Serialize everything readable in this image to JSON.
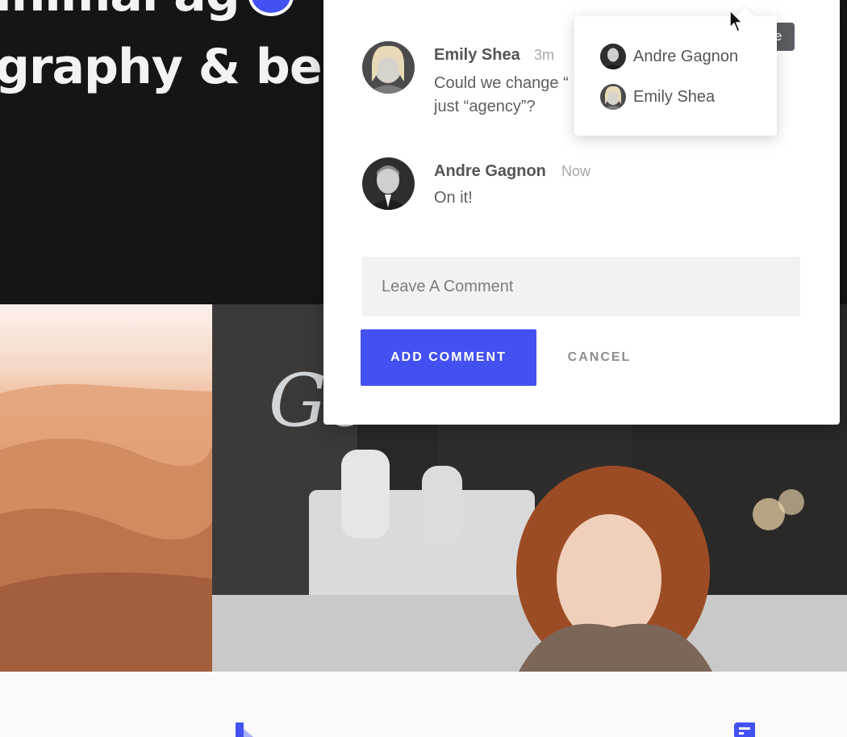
{
  "hero": {
    "line1": "inimal ag",
    "line2": "graphy & bea"
  },
  "comments": [
    {
      "name": "Emily Shea",
      "time": "3m",
      "text": "Could we change “\njust “agency”?"
    },
    {
      "name": "Andre Gagnon",
      "time": "Now",
      "text": "On it!"
    }
  ],
  "comment_box": {
    "placeholder": "Leave A Comment",
    "add_label": "ADD COMMENT",
    "cancel_label": "CANCEL"
  },
  "mentions": [
    {
      "label": "Andre Gagnon"
    },
    {
      "label": "Emily Shea"
    }
  ],
  "tooltip_fragment": "e",
  "colors": {
    "accent": "#4451f2",
    "hero_bg": "#151515",
    "tooltip_bg": "#5a5e63"
  },
  "icons": [
    "user-avatar-icon",
    "mouse-pointer-icon",
    "bookmark-icon",
    "message-icon",
    "anchor-icon"
  ]
}
